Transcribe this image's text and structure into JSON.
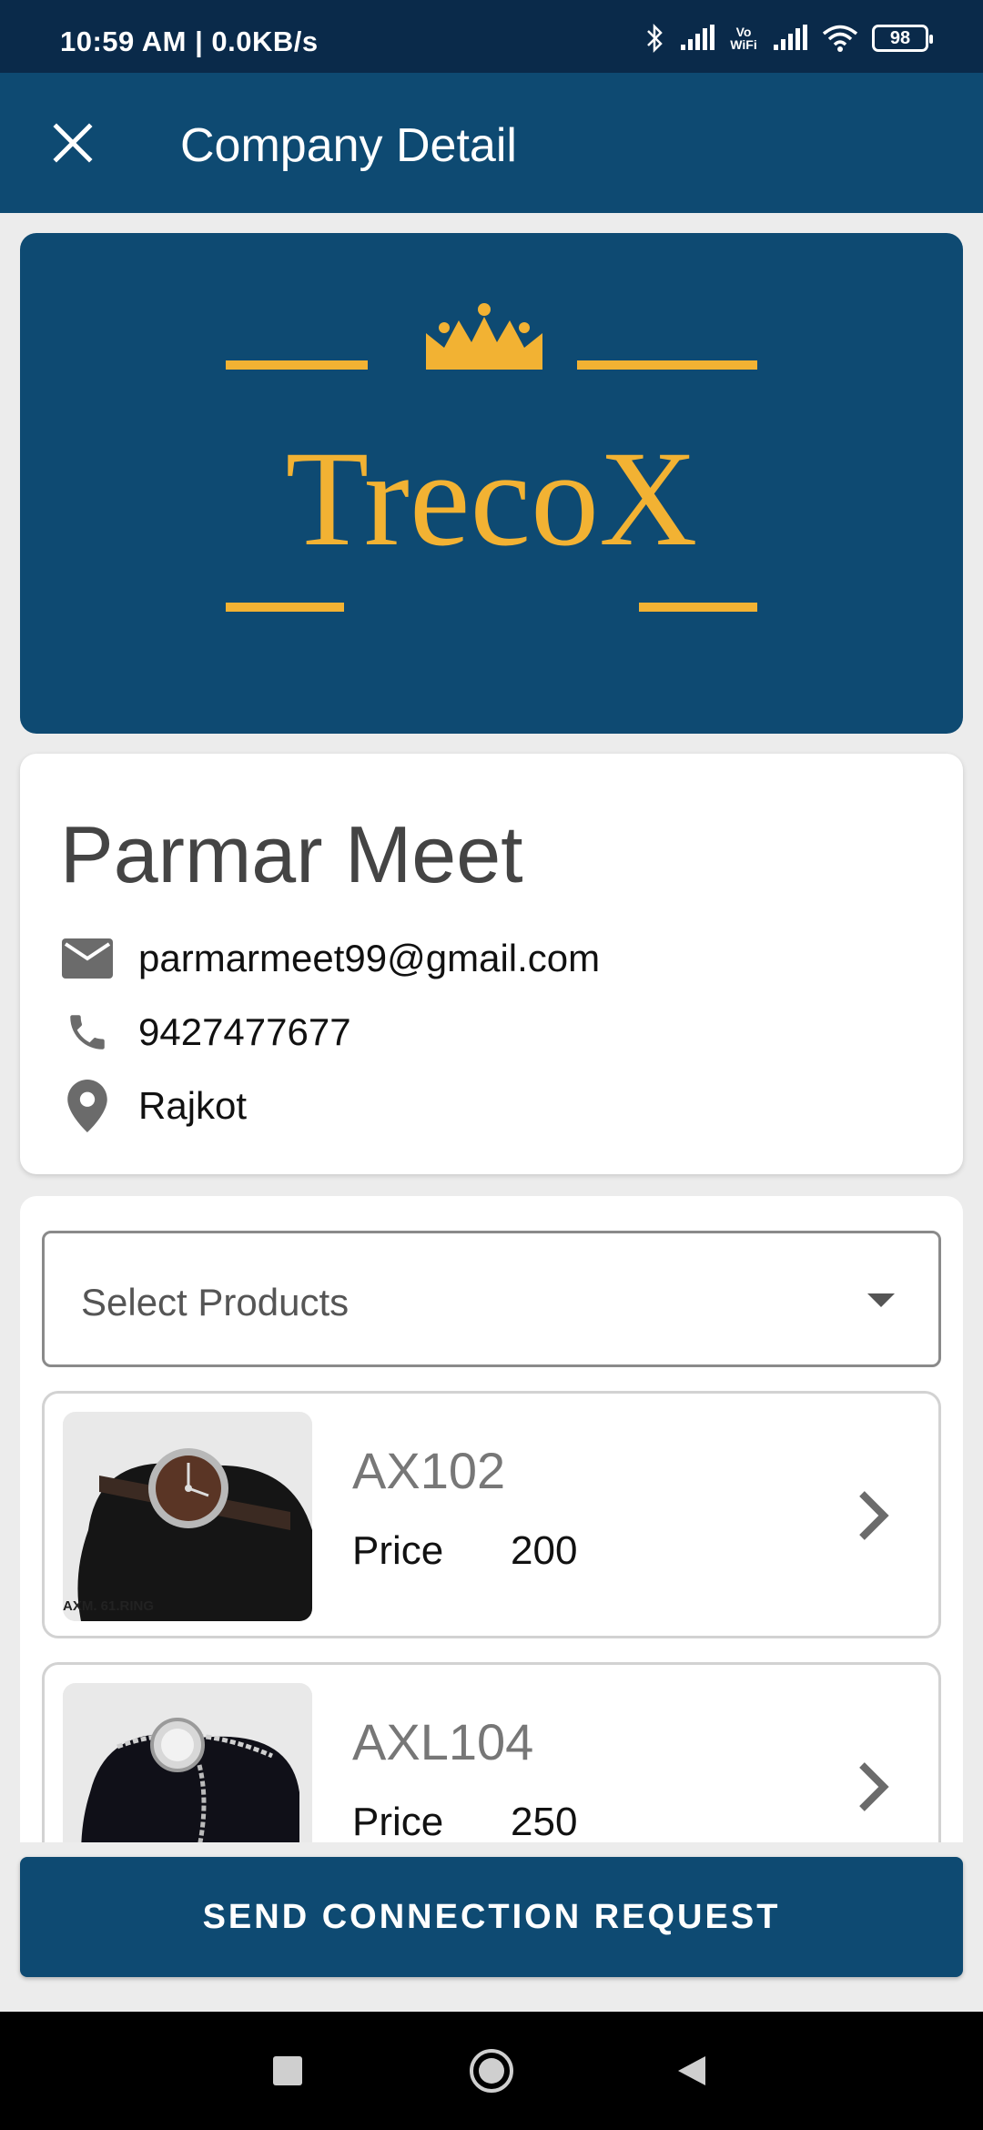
{
  "status_bar": {
    "time": "10:59 AM | 0.0KB/s",
    "wifi_label": "Vo WiFi",
    "battery": "98"
  },
  "app_bar": {
    "title": "Company Detail",
    "close_icon": "close-icon"
  },
  "banner": {
    "logo_text": "TrecoX"
  },
  "company": {
    "name": "Parmar Meet",
    "email": "parmarmeet99@gmail.com",
    "phone": "9427477677",
    "location": "Rajkot"
  },
  "products": {
    "select_placeholder": "Select Products",
    "items": [
      {
        "code": "AX102",
        "price_label": "Price",
        "price": "200",
        "thumb_caption": "AXM. 61.RING"
      },
      {
        "code": "AXL104",
        "price_label": "Price",
        "price": "250",
        "thumb_caption": ""
      }
    ]
  },
  "actions": {
    "send_request": "SEND CONNECTION REQUEST"
  },
  "colors": {
    "primary": "#0e4a72",
    "status_bar": "#0a2a4a",
    "gold": "#f2b233",
    "background": "#ececec"
  }
}
